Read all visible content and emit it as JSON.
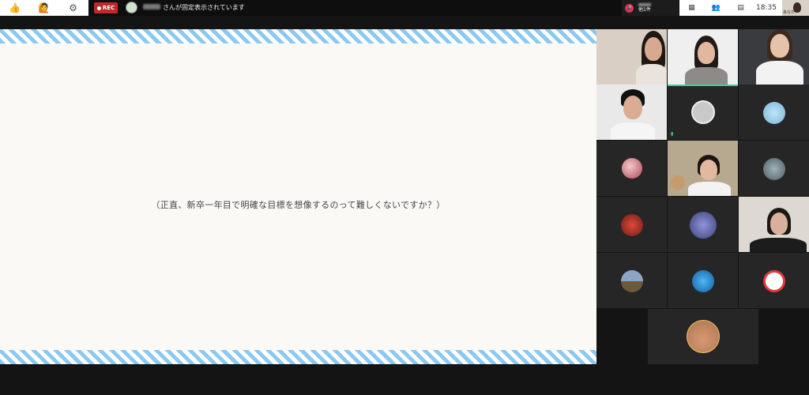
{
  "top_bar": {
    "reactions": [
      {
        "icon": "thumbs-up-icon",
        "glyph": "👍"
      },
      {
        "icon": "raise-hand-icon",
        "glyph": "🙋"
      },
      {
        "icon": "gear-icon",
        "glyph": "⚙"
      }
    ],
    "rec_label": "REC",
    "pinned_message": "さんが固定表示されています",
    "mic_indicator": {
      "count_label": "他1件"
    },
    "controls": [
      {
        "icon": "grid-view-icon",
        "glyph": "▦"
      },
      {
        "icon": "participants-icon",
        "glyph": "👥"
      },
      {
        "icon": "chat-icon",
        "glyph": "▤"
      }
    ],
    "clock": "18:35",
    "self_label": "あなた"
  },
  "slide": {
    "text": "（正直、新卒一年目で明確な目標を想像するのって難しくないですか？）"
  },
  "colors": {
    "stripe_blue": "#8cc9f0",
    "rec_red": "#c0282a",
    "active_speaker": "#2fd39b"
  }
}
